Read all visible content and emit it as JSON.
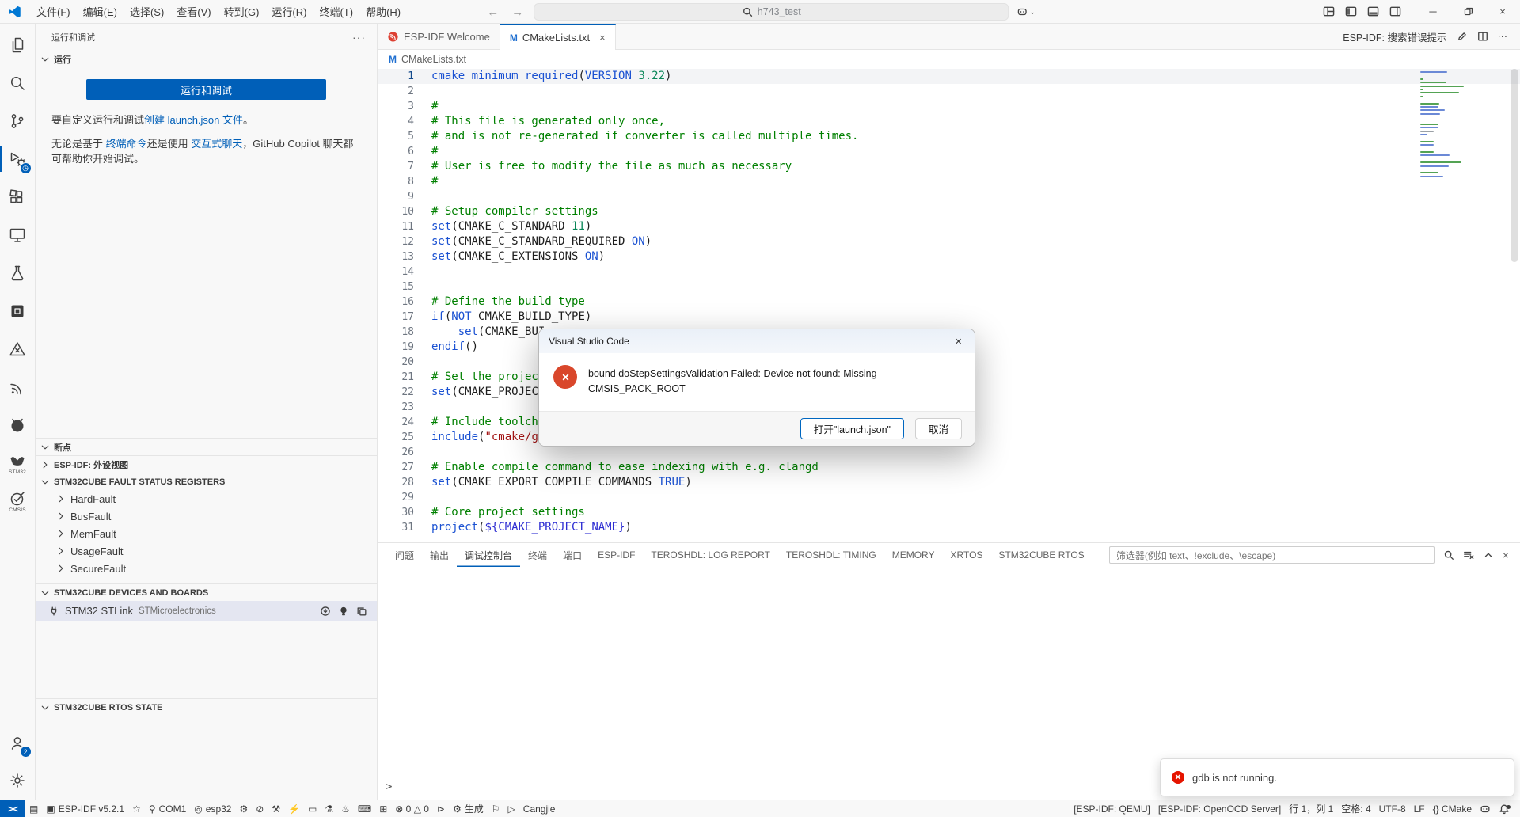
{
  "colors": {
    "accent": "#005fb8",
    "error_red": "#e51400",
    "dialog_error": "#d9472b",
    "comment_green": "#008000",
    "command_blue": "#1a51d2",
    "number_green": "#098658",
    "string_red": "#a31515"
  },
  "titlebar": {
    "menus": [
      "文件(F)",
      "编辑(E)",
      "选择(S)",
      "查看(V)",
      "转到(G)",
      "运行(R)",
      "终端(T)",
      "帮助(H)"
    ],
    "search_value": "h743_test",
    "window_controls": {
      "minimize": "─",
      "restore": "",
      "close": "×"
    }
  },
  "activity_bar": {
    "top": [
      {
        "name": "explorer"
      },
      {
        "name": "search"
      },
      {
        "name": "source-control"
      },
      {
        "name": "run-and-debug",
        "active": true,
        "badge": "clock"
      },
      {
        "name": "extensions"
      },
      {
        "name": "remote-explorer"
      },
      {
        "name": "test-beaker"
      },
      {
        "name": "chip"
      },
      {
        "name": "teroshdl"
      },
      {
        "name": "espressif"
      },
      {
        "name": "github"
      },
      {
        "name": "stm32",
        "label": "STM32"
      },
      {
        "name": "cmsis",
        "label": "CMSIS"
      }
    ],
    "bottom": [
      {
        "name": "accounts",
        "badge": "2"
      },
      {
        "name": "settings"
      }
    ]
  },
  "sidebar": {
    "title": "运行和调试",
    "more": "···",
    "run": {
      "header": "运行",
      "button": "运行和调试",
      "p1": [
        {
          "t": "要自定义运行和调试",
          "link": false
        },
        {
          "t": "创建 launch.json 文件",
          "link": true
        },
        {
          "t": "。",
          "link": false
        }
      ],
      "p2": [
        {
          "t": "无论是基于 ",
          "link": false
        },
        {
          "t": "终端命令",
          "link": true
        },
        {
          "t": "还是使用 ",
          "link": false
        },
        {
          "t": "交互式聊天",
          "link": true
        },
        {
          "t": "，GitHub Copilot 聊天都可帮助你开始调试。",
          "link": false
        }
      ]
    },
    "sections": [
      {
        "name": "breakpoints",
        "label": "断点",
        "collapsed": false
      },
      {
        "name": "esp-idf-peripherals",
        "label": "ESP-IDF: 外设视图",
        "collapsed": true
      },
      {
        "name": "stm32-fault-registers",
        "label": "STM32CUBE FAULT STATUS REGISTERS",
        "collapsed": false,
        "rows": [
          "HardFault",
          "BusFault",
          "MemFault",
          "UsageFault",
          "SecureFault"
        ]
      },
      {
        "name": "stm32-devices",
        "label": "STM32CUBE DEVICES AND BOARDS",
        "collapsed": false,
        "device": {
          "title": "STM32 STLink",
          "vendor": "STMicroelectronics"
        }
      },
      {
        "name": "stm32-rtos-state",
        "label": "STM32CUBE RTOS STATE",
        "collapsed": false
      }
    ]
  },
  "editor": {
    "tabs": [
      {
        "label": "ESP-IDF Welcome",
        "icon": "espressif-red",
        "active": false,
        "close": false
      },
      {
        "label": "CMakeLists.txt",
        "icon": "cmake-m",
        "active": true,
        "close": true
      }
    ],
    "breadcrumb": {
      "icon": "cmake-m",
      "label": "CMakeLists.txt"
    },
    "toolbar": {
      "hint": "ESP-IDF: 搜索错误提示",
      "more": "···"
    },
    "code_lines": [
      [
        [
          "cmake_minimum_required",
          "fn"
        ],
        [
          "(",
          "p"
        ],
        [
          "VERSION",
          "kw"
        ],
        [
          " ",
          "p"
        ],
        [
          "3.22",
          "num"
        ],
        [
          ")",
          "p"
        ]
      ],
      [],
      [
        [
          "#",
          "cmt"
        ]
      ],
      [
        [
          "# This file is generated only once,",
          "cmt"
        ]
      ],
      [
        [
          "# and is not re-generated if converter is called multiple times.",
          "cmt"
        ]
      ],
      [
        [
          "#",
          "cmt"
        ]
      ],
      [
        [
          "# User is free to modify the file as much as necessary",
          "cmt"
        ]
      ],
      [
        [
          "#",
          "cmt"
        ]
      ],
      [],
      [
        [
          "# Setup compiler settings",
          "cmt"
        ]
      ],
      [
        [
          "set",
          "fn"
        ],
        [
          "(CMAKE_C_STANDARD ",
          "p"
        ],
        [
          "11",
          "num"
        ],
        [
          ")",
          "p"
        ]
      ],
      [
        [
          "set",
          "fn"
        ],
        [
          "(CMAKE_C_STANDARD_REQUIRED ",
          "p"
        ],
        [
          "ON",
          "kw"
        ],
        [
          ")",
          "p"
        ]
      ],
      [
        [
          "set",
          "fn"
        ],
        [
          "(CMAKE_C_EXTENSIONS ",
          "p"
        ],
        [
          "ON",
          "kw"
        ],
        [
          ")",
          "p"
        ]
      ],
      [],
      [],
      [
        [
          "# Define the build type",
          "cmt"
        ]
      ],
      [
        [
          "if",
          "fn"
        ],
        [
          "(",
          "p"
        ],
        [
          "NOT",
          "kw"
        ],
        [
          " CMAKE_BUILD_TYPE)",
          "p"
        ]
      ],
      [
        [
          "    ",
          "p"
        ],
        [
          "set",
          "fn"
        ],
        [
          "(CMAKE_BUI",
          "p"
        ]
      ],
      [
        [
          "endif",
          "fn"
        ],
        [
          "()",
          "p"
        ]
      ],
      [],
      [
        [
          "# Set the project",
          "cmt"
        ]
      ],
      [
        [
          "set",
          "fn"
        ],
        [
          "(CMAKE_PROJECT",
          "p"
        ]
      ],
      [],
      [
        [
          "# Include toolcha",
          "cmt"
        ]
      ],
      [
        [
          "include",
          "fn"
        ],
        [
          "(",
          "p"
        ],
        [
          "\"cmake/gcc-arm-none-eabi.cmake\"",
          "str"
        ],
        [
          ")",
          "p"
        ]
      ],
      [],
      [
        [
          "# Enable compile command to ease indexing with e.g. clangd",
          "cmt"
        ]
      ],
      [
        [
          "set",
          "fn"
        ],
        [
          "(CMAKE_EXPORT_COMPILE_COMMANDS ",
          "p"
        ],
        [
          "TRUE",
          "kw"
        ],
        [
          ")",
          "p"
        ]
      ],
      [],
      [
        [
          "# Core project settings",
          "cmt"
        ]
      ],
      [
        [
          "project",
          "fn"
        ],
        [
          "(",
          "p"
        ],
        [
          "${CMAKE_PROJECT_NAME}",
          "var"
        ],
        [
          ")",
          "p"
        ]
      ]
    ]
  },
  "panel": {
    "tabs": [
      {
        "label": "问题"
      },
      {
        "label": "输出"
      },
      {
        "label": "调试控制台",
        "active": true
      },
      {
        "label": "终端"
      },
      {
        "label": "端口"
      },
      {
        "label": "ESP-IDF"
      },
      {
        "label": "TEROSHDL: LOG REPORT"
      },
      {
        "label": "TEROSHDL: TIMING"
      },
      {
        "label": "MEMORY"
      },
      {
        "label": "XRTOS"
      },
      {
        "label": "STM32CUBE RTOS"
      }
    ],
    "filter_placeholder": "筛选器(例如 text、!exclude、\\escape)",
    "prompt": ">"
  },
  "dialog": {
    "title": "Visual Studio Code",
    "message": "bound doStepSettingsValidation Failed: Device not found: Missing CMSIS_PACK_ROOT",
    "primary_button": "打开\"launch.json\"",
    "secondary_button": "取消"
  },
  "notification": {
    "message": "gdb is not running."
  },
  "status_bar": {
    "left": [
      {
        "n": "remote-indicator",
        "g": "><",
        "remote": true
      },
      {
        "n": "project-icon",
        "g": "▤"
      },
      {
        "n": "espidf-version",
        "g": "▣",
        "l": "ESP-IDF v5.2.1"
      },
      {
        "n": "star-icon",
        "g": "☆"
      },
      {
        "n": "serial-port",
        "g": "⚲",
        "l": "COM1"
      },
      {
        "n": "device-target",
        "g": "◎",
        "l": "esp32"
      },
      {
        "n": "menuconfig-icon",
        "g": "⚙"
      },
      {
        "n": "full-clean-icon",
        "g": "⊘"
      },
      {
        "n": "build-tools-icon",
        "g": "⚒"
      },
      {
        "n": "flash-icon",
        "g": "⚡"
      },
      {
        "n": "monitor-icon",
        "g": "▭"
      },
      {
        "n": "debug-flask-icon",
        "g": "⚗"
      },
      {
        "n": "flame-icon",
        "g": "♨"
      },
      {
        "n": "terminal-icon",
        "g": "⌨"
      },
      {
        "n": "new-window-icon",
        "g": "⊞"
      },
      {
        "n": "problems",
        "l": "⊗ 0  △ 0"
      },
      {
        "n": "debug-alt-icon",
        "g": "⊳"
      },
      {
        "n": "cmake-build",
        "g": "⚙",
        "l": "生成"
      },
      {
        "n": "flag-icon",
        "g": "⚐"
      },
      {
        "n": "launch-icon",
        "g": "▷"
      },
      {
        "n": "launch-target",
        "l": "Cangjie"
      }
    ],
    "right": [
      {
        "n": "espidf-qemu",
        "l": "[ESP-IDF: QEMU]"
      },
      {
        "n": "espidf-openocd",
        "l": "[ESP-IDF: OpenOCD Server]"
      },
      {
        "n": "cursor-position",
        "l": "行 1，列 1"
      },
      {
        "n": "indentation",
        "l": "空格: 4"
      },
      {
        "n": "encoding",
        "l": "UTF-8"
      },
      {
        "n": "eol",
        "l": "LF"
      },
      {
        "n": "language-mode",
        "l": "{} CMake"
      },
      {
        "n": "copilot-icon",
        "svg": "copilot"
      },
      {
        "n": "bell-icon",
        "svg": "bell"
      }
    ]
  }
}
